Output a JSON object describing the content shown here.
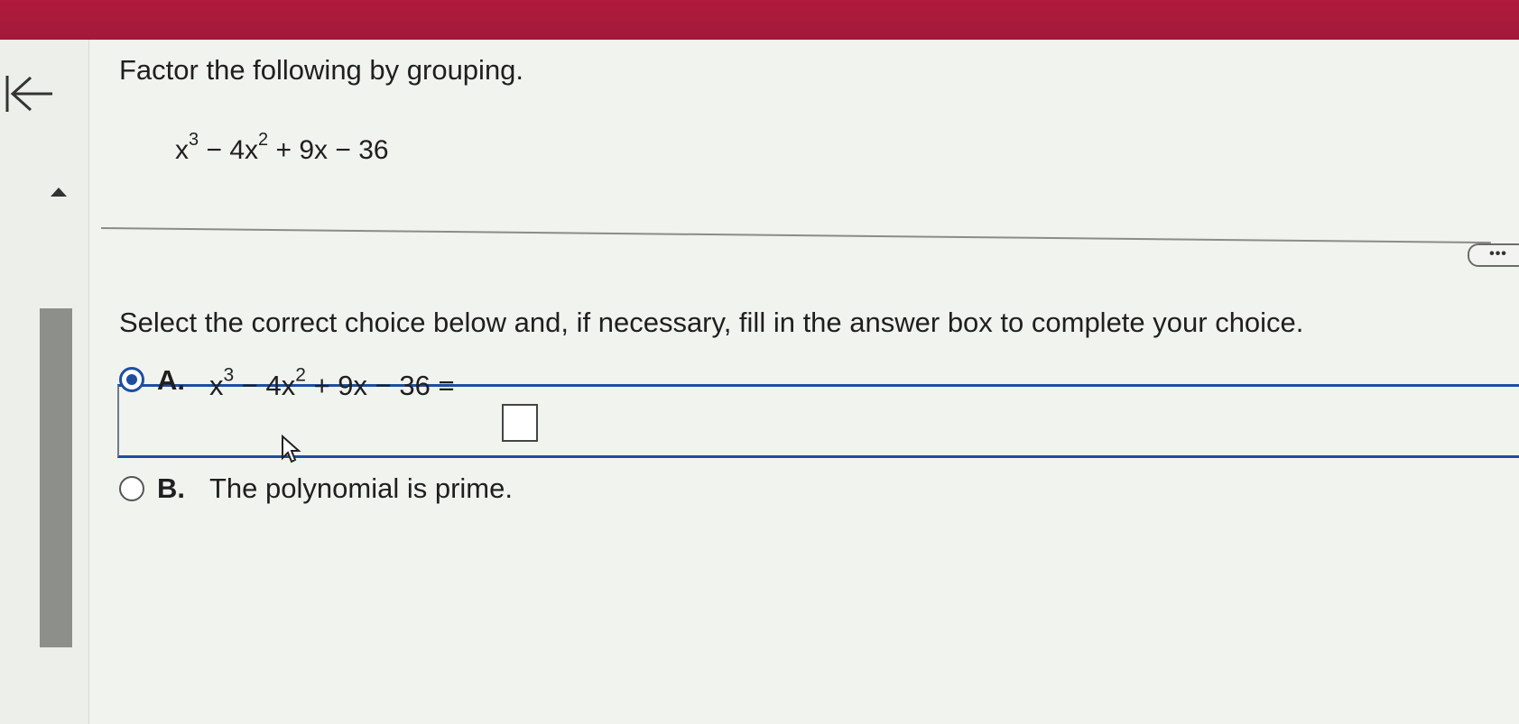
{
  "navigation": {
    "back_icon": "arrow-left-icon",
    "collapse_icon": "caret-up-icon"
  },
  "question": {
    "instruction": "Factor the following by grouping.",
    "expression": {
      "t1_base": "x",
      "t1_exp": "3",
      "t2_base": " − 4x",
      "t2_exp": "2",
      "rest": " + 9x − 36"
    }
  },
  "more_button": {
    "label": "•••"
  },
  "prompt": "Select the correct choice below and, if necessary, fill in the answer box to complete your choice.",
  "choices": [
    {
      "letter": "A.",
      "selected": true,
      "t1_base": "x",
      "t1_exp": "3",
      "t2_base": " − 4x",
      "t2_exp": "2",
      "rest": " + 9x − 36  =",
      "answer_value": ""
    },
    {
      "letter": "B.",
      "selected": false,
      "text": "The polynomial is prime."
    }
  ],
  "colors": {
    "header": "#a3193a",
    "accent": "#1d4f9f",
    "sidebar_scrollbar": "#8d8f8b"
  }
}
